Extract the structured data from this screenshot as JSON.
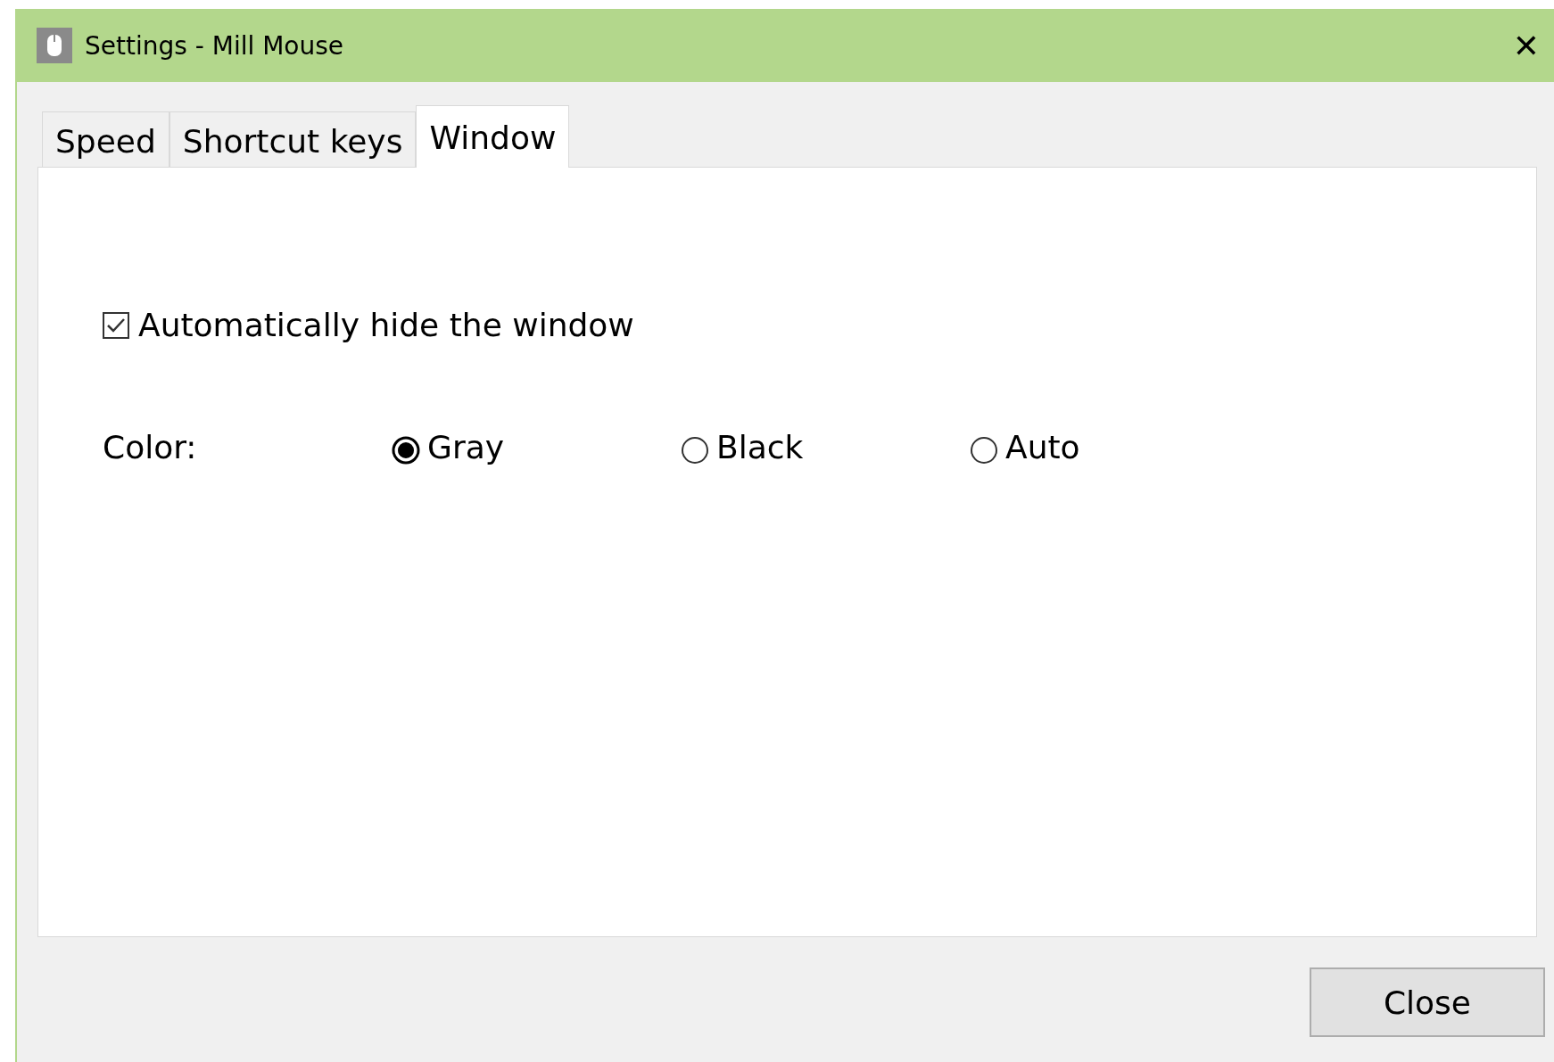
{
  "window": {
    "title": "Settings - Mill Mouse",
    "close_glyph": "✕"
  },
  "tabs": [
    {
      "label": "Speed",
      "selected": false
    },
    {
      "label": "Shortcut keys",
      "selected": false
    },
    {
      "label": "Window",
      "selected": true
    }
  ],
  "auto_hide": {
    "label": "Automatically hide the window",
    "checked": true
  },
  "color": {
    "label": "Color:",
    "options": [
      {
        "label": "Gray",
        "selected": true
      },
      {
        "label": "Black",
        "selected": false
      },
      {
        "label": "Auto",
        "selected": false
      }
    ]
  },
  "buttons": [
    "Close"
  ]
}
